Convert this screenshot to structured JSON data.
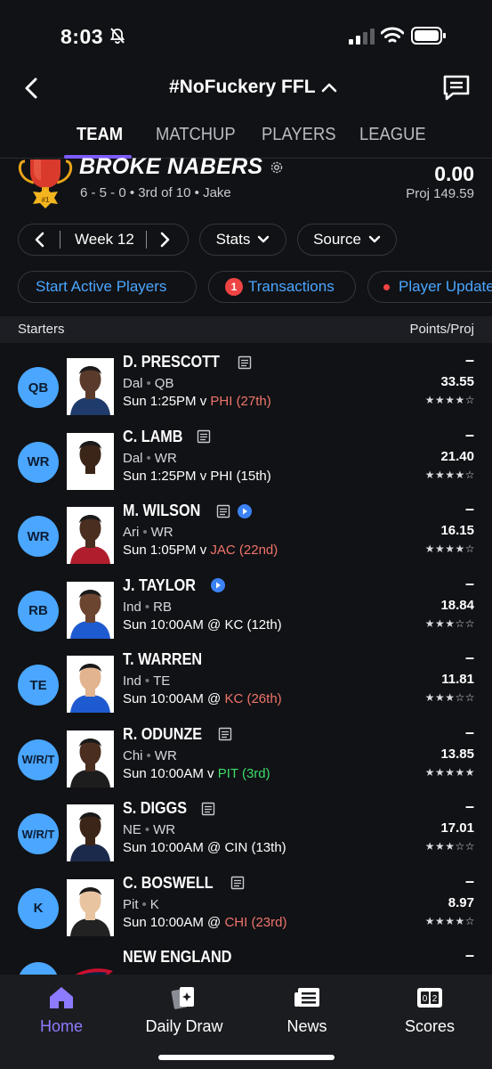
{
  "status_bar": {
    "time": "8:03"
  },
  "header": {
    "league_name": "#NoFuckery FFL"
  },
  "tabs": [
    {
      "label": "TEAM"
    },
    {
      "label": "MATCHUP"
    },
    {
      "label": "PLAYERS"
    },
    {
      "label": "LEAGUE"
    }
  ],
  "team": {
    "name": "BROKE NABERS",
    "rank_badge": "#1",
    "record": "6 - 5 - 0 • 3rd of 10 • Jake",
    "score": "0.00",
    "proj": "Proj 149.59"
  },
  "controls": {
    "week": "Week 12",
    "stats": "Stats",
    "source": "Source"
  },
  "actions": {
    "start_active": "Start Active Players",
    "transactions_count": "1",
    "transactions": "Transactions",
    "player_updates": "Player Updates"
  },
  "section": {
    "left": "Starters",
    "right": "Points/Proj"
  },
  "players": [
    {
      "pos": "QB",
      "name": "D. PRESCOTT",
      "team": "Dal",
      "position": "QB",
      "time": "Sun 1:25PM v ",
      "opp": "PHI (27th)",
      "opp_color": "red",
      "points": "–",
      "proj": "33.55",
      "rating": 4,
      "note": true,
      "play": false
    },
    {
      "pos": "WR",
      "name": "C. LAMB",
      "team": "Dal",
      "position": "WR",
      "time": "Sun 1:25PM v ",
      "opp": "PHI (15th)",
      "opp_color": "white",
      "points": "–",
      "proj": "21.40",
      "rating": 4,
      "note": true,
      "play": false
    },
    {
      "pos": "WR",
      "name": "M. WILSON",
      "team": "Ari",
      "position": "WR",
      "time": "Sun 1:05PM v ",
      "opp": "JAC (22nd)",
      "opp_color": "red",
      "points": "–",
      "proj": "16.15",
      "rating": 4,
      "note": true,
      "play": true
    },
    {
      "pos": "RB",
      "name": "J. TAYLOR",
      "team": "Ind",
      "position": "RB",
      "time": "Sun 10:00AM @ ",
      "opp": "KC (12th)",
      "opp_color": "white",
      "points": "–",
      "proj": "18.84",
      "rating": 3,
      "note": false,
      "play": true
    },
    {
      "pos": "TE",
      "name": "T. WARREN",
      "team": "Ind",
      "position": "TE",
      "time": "Sun 10:00AM @ ",
      "opp": "KC (26th)",
      "opp_color": "red",
      "points": "–",
      "proj": "11.81",
      "rating": 3,
      "note": false,
      "play": false
    },
    {
      "pos": "W/R/T",
      "name": "R. ODUNZE",
      "team": "Chi",
      "position": "WR",
      "time": "Sun 10:00AM v ",
      "opp": "PIT (3rd)",
      "opp_color": "green",
      "points": "–",
      "proj": "13.85",
      "rating": 5,
      "note": true,
      "play": false
    },
    {
      "pos": "W/R/T",
      "name": "S. DIGGS",
      "team": "NE",
      "position": "WR",
      "time": "Sun 10:00AM @ ",
      "opp": "CIN (13th)",
      "opp_color": "white",
      "points": "–",
      "proj": "17.01",
      "rating": 3,
      "note": true,
      "play": false
    },
    {
      "pos": "K",
      "name": "C. BOSWELL",
      "team": "Pit",
      "position": "K",
      "time": "Sun 10:00AM @ ",
      "opp": "CHI (23rd)",
      "opp_color": "red",
      "points": "–",
      "proj": "8.97",
      "rating": 4,
      "note": true,
      "play": false
    },
    {
      "pos": "DEF",
      "name": "NEW ENGLAND",
      "team": "",
      "position": "",
      "time": "",
      "opp": "",
      "opp_color": "white",
      "points": "–",
      "proj": "",
      "rating": 0,
      "note": false,
      "play": false
    }
  ],
  "bottom_nav": [
    {
      "label": "Home",
      "icon": "home-icon"
    },
    {
      "label": "Daily Draw",
      "icon": "daily-draw-icon"
    },
    {
      "label": "News",
      "icon": "news-icon"
    },
    {
      "label": "Scores",
      "icon": "scores-icon"
    }
  ],
  "colors": {
    "accent": "#7b5cff",
    "link": "#4aa6ff",
    "position_badge": "#4aa6ff",
    "bad_matchup": "#f0746b",
    "good_matchup": "#3ddc6b"
  }
}
